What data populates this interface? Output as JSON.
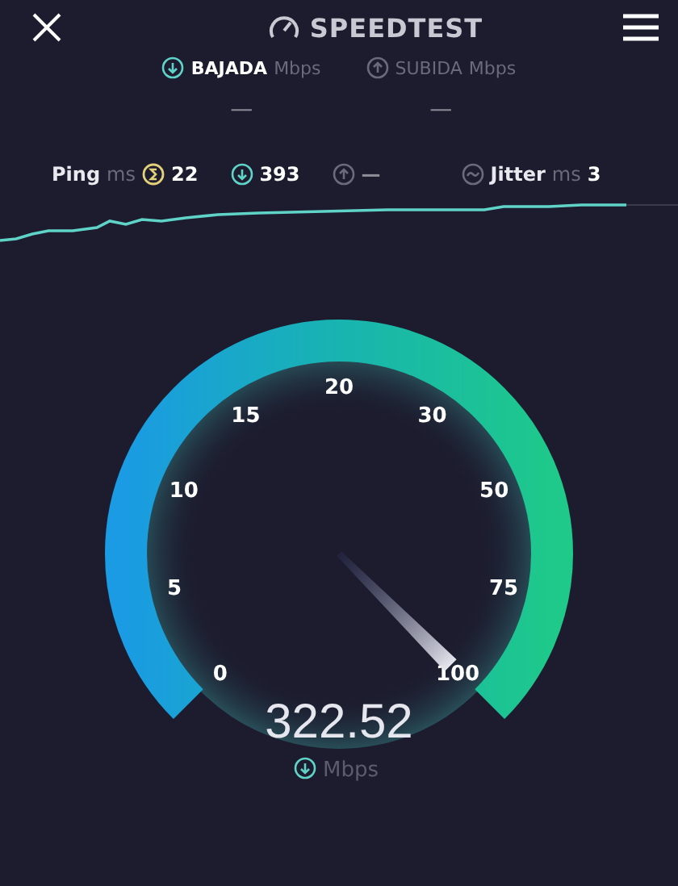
{
  "header": {
    "title": "SPEEDTEST"
  },
  "tabs": [
    {
      "label": "BAJADA",
      "unit": "Mbps",
      "value": "—",
      "kind": "download",
      "selected": true
    },
    {
      "label": "SUBIDA",
      "unit": "Mbps",
      "value": "—",
      "kind": "upload",
      "selected": false
    }
  ],
  "stats": [
    {
      "kind": "ping",
      "label": "Ping",
      "unit": "ms",
      "value": "22"
    },
    {
      "kind": "download",
      "value": "393"
    },
    {
      "kind": "upload",
      "value": "—"
    },
    {
      "kind": "jitter",
      "label": "Jitter",
      "unit": "ms",
      "value": "3"
    }
  ],
  "gauge": {
    "tick_labels": [
      "0",
      "5",
      "10",
      "15",
      "20",
      "30",
      "50",
      "75",
      "100"
    ],
    "reading": "322.52",
    "unit": "Mbps"
  }
}
